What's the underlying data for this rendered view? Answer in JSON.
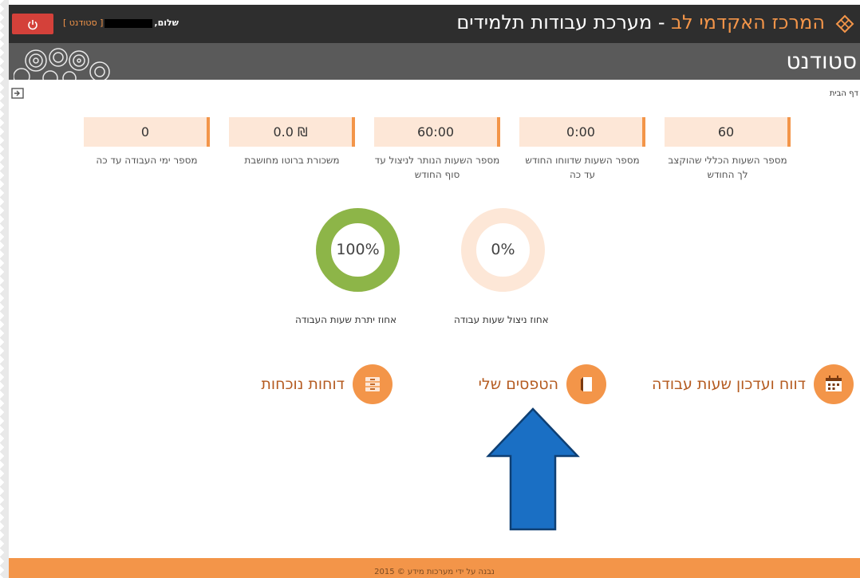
{
  "header": {
    "brand_accent": "המרכז האקדמי לב",
    "brand_rest": " - מערכת עבודות תלמידים",
    "logout_icon": "power-icon",
    "user_greeting": "שלום,",
    "user_role": "[ סטודנט ]"
  },
  "subheader": {
    "title": "סטודנט"
  },
  "breadcrumb": "דף הבית",
  "stats": [
    {
      "value": "60",
      "label": "מספר השעות הכללי שהוקצב לך החודש"
    },
    {
      "value": "0:00",
      "label": "מספר השעות שדווחו החודש עד כה"
    },
    {
      "value": "60:00",
      "label": "מספר השעות הנותר לניצול עד סוף החודש"
    },
    {
      "value": "0.0 ₪",
      "label": "משכורת ברוטו מחושבת"
    },
    {
      "value": "0",
      "label": "מספר ימי העבודה עד כה"
    }
  ],
  "donuts": [
    {
      "value_text": "0%",
      "fraction": 0.0,
      "caption": "אחוז ניצול שעות עבודה",
      "color": "#fde7d7"
    },
    {
      "value_text": "100%",
      "fraction": 1.0,
      "caption": "אחוז יתרת שעות העבודה",
      "color": "#8db548"
    }
  ],
  "nav": [
    {
      "label": "דווח ועדכון שעות עבודה",
      "icon": "calendar-icon"
    },
    {
      "label": "הטפסים שלי",
      "icon": "document-icon"
    },
    {
      "label": "דוחות נוכחות",
      "icon": "archive-icon"
    }
  ],
  "footer": {
    "text": "נבנה על ידי מערכות מידע © 2015"
  },
  "colors": {
    "accent": "#f39549",
    "topbar": "#2e2e2e",
    "subbar": "#5a5a5a",
    "logout": "#d4413a",
    "annotation_arrow": "#1a6fc4"
  }
}
